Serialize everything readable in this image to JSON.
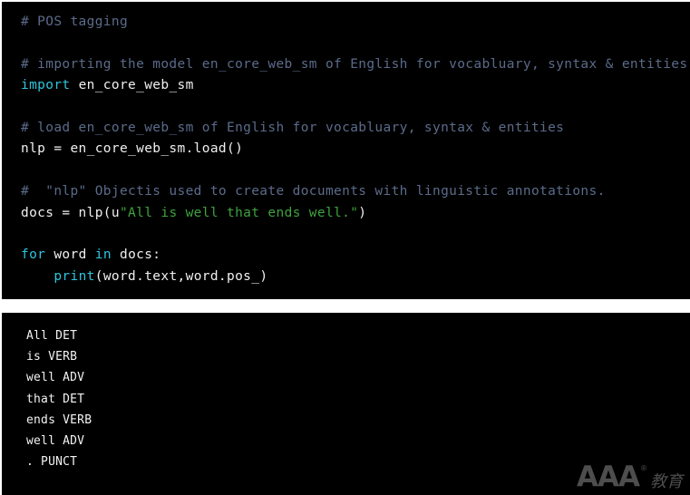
{
  "colors": {
    "background": "#000000",
    "separator": "#ffffff",
    "comment": "#5b6b8a",
    "keyword": "#2ec4dd",
    "string": "#3ea33e",
    "plain": "#f0f0f0",
    "output_text": "#f2f2f2",
    "watermark": "#4d4d4d"
  },
  "code_panel": {
    "language": "python",
    "lines": [
      {
        "tokens": [
          {
            "text": "# POS tagging",
            "type": "comment"
          }
        ]
      },
      {
        "tokens": [
          {
            "text": "",
            "type": "blank"
          }
        ]
      },
      {
        "tokens": [
          {
            "text": "# importing the model en_core_web_sm of English for vocabluary, syntax & entities",
            "type": "comment"
          }
        ]
      },
      {
        "tokens": [
          {
            "text": "import",
            "type": "keyword"
          },
          {
            "text": " en_core_web_sm",
            "type": "plain"
          }
        ]
      },
      {
        "tokens": [
          {
            "text": "",
            "type": "blank"
          }
        ]
      },
      {
        "tokens": [
          {
            "text": "# load en_core_web_sm of English for vocabluary, syntax & entities",
            "type": "comment"
          }
        ]
      },
      {
        "tokens": [
          {
            "text": "nlp = en_core_web_sm.load()",
            "type": "plain"
          }
        ]
      },
      {
        "tokens": [
          {
            "text": "",
            "type": "blank"
          }
        ]
      },
      {
        "tokens": [
          {
            "text": "#  \"nlp\" Objectis used to create documents with linguistic annotations.",
            "type": "comment"
          }
        ]
      },
      {
        "tokens": [
          {
            "text": "docs = nlp(u",
            "type": "plain"
          },
          {
            "text": "\"All is well that ends well.\"",
            "type": "string"
          },
          {
            "text": ")",
            "type": "plain"
          }
        ]
      },
      {
        "tokens": [
          {
            "text": "",
            "type": "blank"
          }
        ]
      },
      {
        "tokens": [
          {
            "text": "for",
            "type": "keyword"
          },
          {
            "text": " word ",
            "type": "plain"
          },
          {
            "text": "in",
            "type": "keyword"
          },
          {
            "text": " docs:",
            "type": "plain"
          }
        ]
      },
      {
        "tokens": [
          {
            "text": "    ",
            "type": "plain"
          },
          {
            "text": "print",
            "type": "builtin"
          },
          {
            "text": "(word.text,word.pos_)",
            "type": "plain"
          }
        ]
      }
    ]
  },
  "output_panel": {
    "lines": [
      "All DET",
      "is VERB",
      "well ADV",
      "that DET",
      "ends VERB",
      "well ADV",
      ". PUNCT"
    ]
  },
  "watermark": {
    "brand": "AAA",
    "registered": "®",
    "chinese": "教育"
  }
}
